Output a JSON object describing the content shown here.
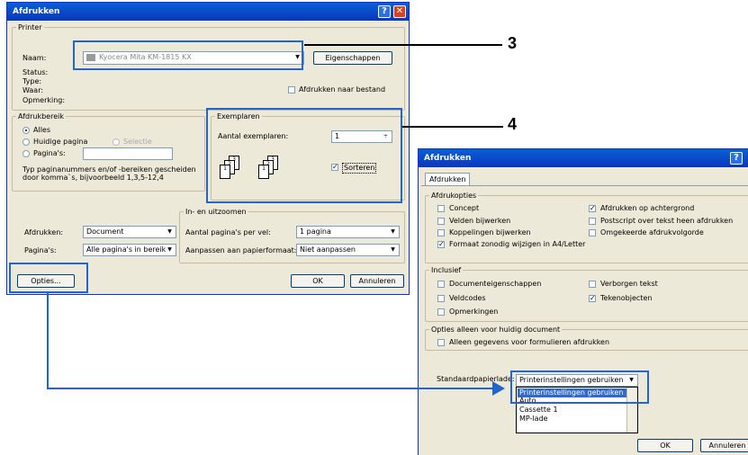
{
  "d1": {
    "title": "Afdrukken",
    "printer": {
      "legend": "Printer",
      "name_label": "Naam:",
      "name_value": "Kyocera Mita KM-1815 KX",
      "props_btn": "Eigenschappen",
      "status": "Status:",
      "type": "Type:",
      "where": "Waar:",
      "comment": "Opmerking:",
      "to_file": "Afdrukken naar bestand"
    },
    "range": {
      "legend": "Afdrukbereik",
      "all": "Alles",
      "current": "Huidige pagina",
      "selection": "Selectie",
      "pages": "Pagina's:",
      "hint1": "Typ paginanummers en/of -bereiken gescheiden",
      "hint2": "door komma`s, bijvoorbeeld 1,3,5-12,4"
    },
    "copies": {
      "legend": "Exemplaren",
      "count_label": "Aantal exemplaren:",
      "count_value": "1",
      "collate": "Sorteren"
    },
    "print_what_label": "Afdrukken:",
    "print_what_value": "Document",
    "pages_label": "Pagina's:",
    "pages_value": "Alle pagina's in bereik",
    "zoom": {
      "legend": "In- en uitzoomen",
      "per_sheet_label": "Aantal pagina's per vel:",
      "per_sheet_value": "1 pagina",
      "scale_label": "Aanpassen aan papierformaat:",
      "scale_value": "Niet aanpassen"
    },
    "options_btn": "Opties...",
    "ok": "OK",
    "cancel": "Annuleren"
  },
  "d2": {
    "title": "Afdrukken",
    "tab": "Afdrukken",
    "opts_legend": "Afdrukopties",
    "opts": [
      "Concept",
      "Velden bijwerken",
      "Koppelingen bijwerken",
      "Formaat zonodig wijzigen in A4/Letter",
      "Afdrukken op achtergrond",
      "Postscript over tekst heen afdrukken",
      "Omgekeerde afdrukvolgorde"
    ],
    "incl_legend": "Inclusief",
    "incl": [
      "Documenteigenschappen",
      "Veldcodes",
      "Opmerkingen",
      "Verborgen tekst",
      "Tekenobjecten"
    ],
    "doc_legend": "Opties alleen voor huidig document",
    "doc_opt": "Alleen gegevens voor formulieren afdrukken",
    "tray_label": "Standaardpapierlade:",
    "tray_value": "Printerinstellingen gebruiken",
    "tray_list": [
      "Printerinstellingen gebruiken",
      "Auto",
      "Cassette 1",
      "MP-lade"
    ],
    "ok": "OK",
    "cancel": "Annuleren"
  },
  "callouts": {
    "c3": "3",
    "c4": "4"
  },
  "colors": {
    "highlight": "#2266cc",
    "titlebar": "#0a46c8"
  }
}
